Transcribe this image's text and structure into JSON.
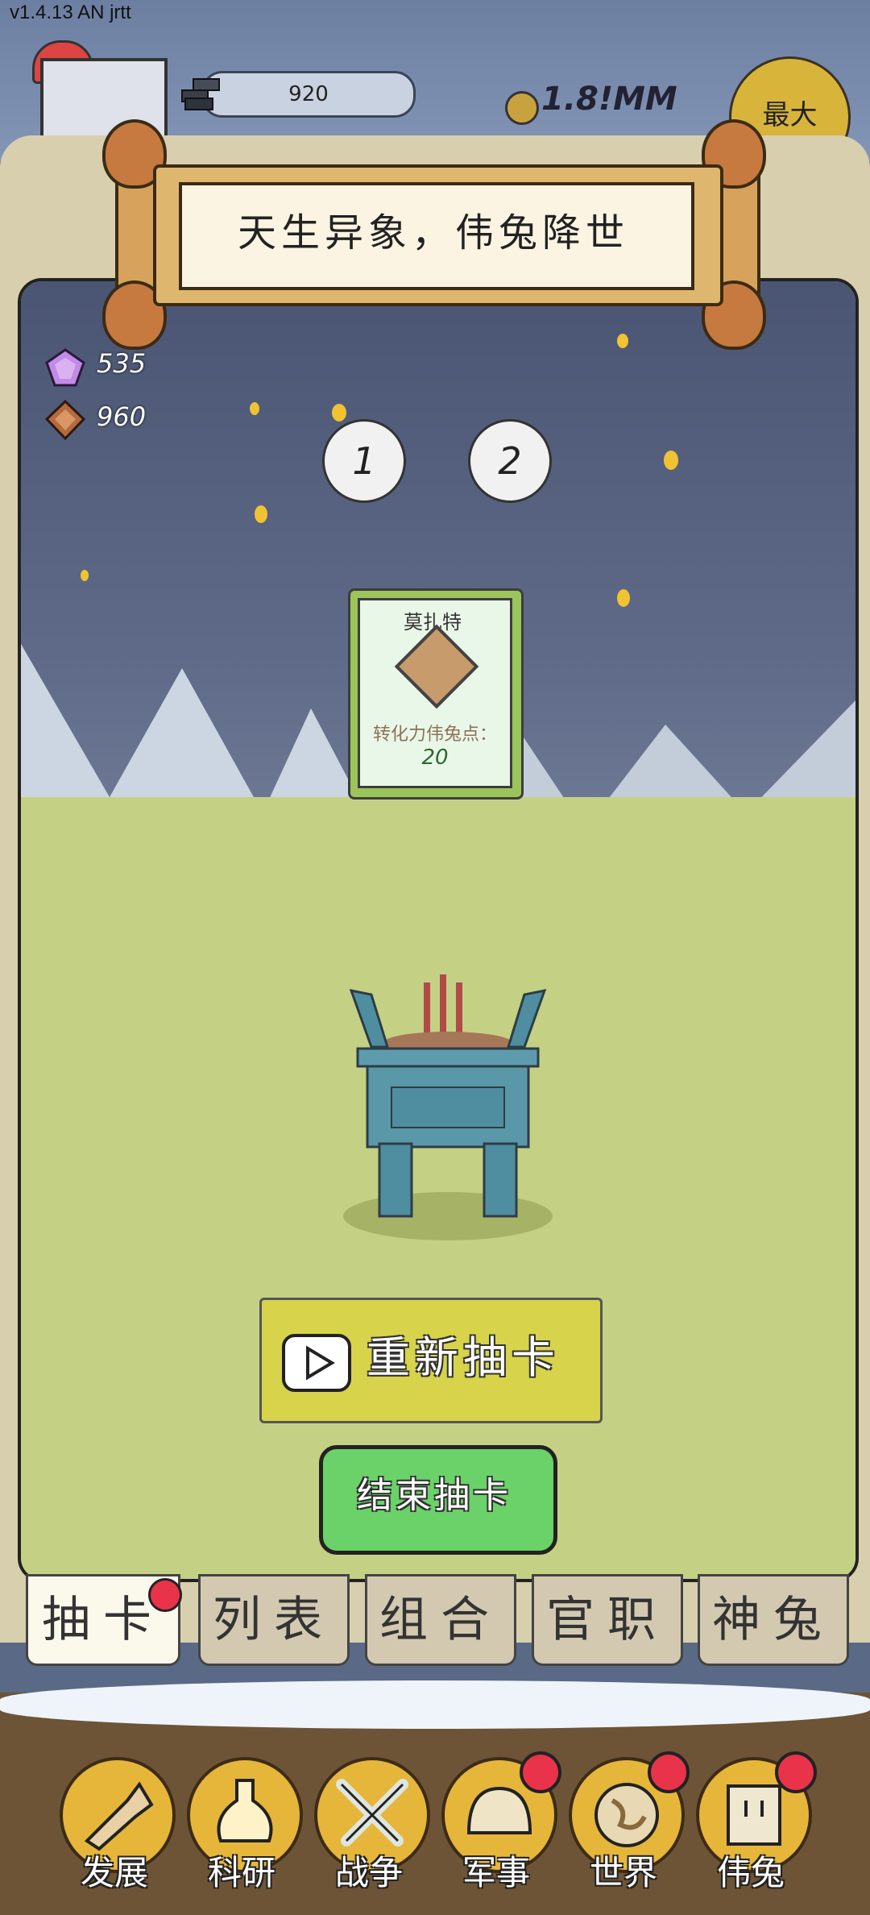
{
  "version": "v1.4.13 AN jrtt",
  "hud": {
    "stone_value": "920",
    "money": "1.8!MM",
    "max_button": "最大"
  },
  "banner": {
    "title": "天生异象，伟兔降世"
  },
  "resources": {
    "gems": "535",
    "fruit": "960"
  },
  "draw_slots": [
    "1",
    "2"
  ],
  "card": {
    "name": "莫扎特",
    "text": "转化力伟兔点：",
    "value": "20"
  },
  "buttons": {
    "redraw": "重新抽卡",
    "end": "结束抽卡"
  },
  "tabs": [
    {
      "label": "抽卡",
      "active": true,
      "badge": true
    },
    {
      "label": "列表",
      "active": false,
      "badge": false
    },
    {
      "label": "组合",
      "active": false,
      "badge": false
    },
    {
      "label": "官职",
      "active": false,
      "badge": false
    },
    {
      "label": "神兔",
      "active": false,
      "badge": false
    }
  ],
  "nav": [
    {
      "label": "发展",
      "icon": "axe-icon",
      "badge": false
    },
    {
      "label": "科研",
      "icon": "flask-icon",
      "badge": false
    },
    {
      "label": "战争",
      "icon": "crossed-swords-icon",
      "badge": false
    },
    {
      "label": "军事",
      "icon": "helmet-icon",
      "badge": true
    },
    {
      "label": "世界",
      "icon": "globe-icon",
      "badge": true
    },
    {
      "label": "伟兔",
      "icon": "rabbit-portrait-icon",
      "badge": true
    }
  ],
  "colors": {
    "accent_green": "#6bd169",
    "accent_yellow": "#d7d34a",
    "badge_red": "#e9334b"
  }
}
